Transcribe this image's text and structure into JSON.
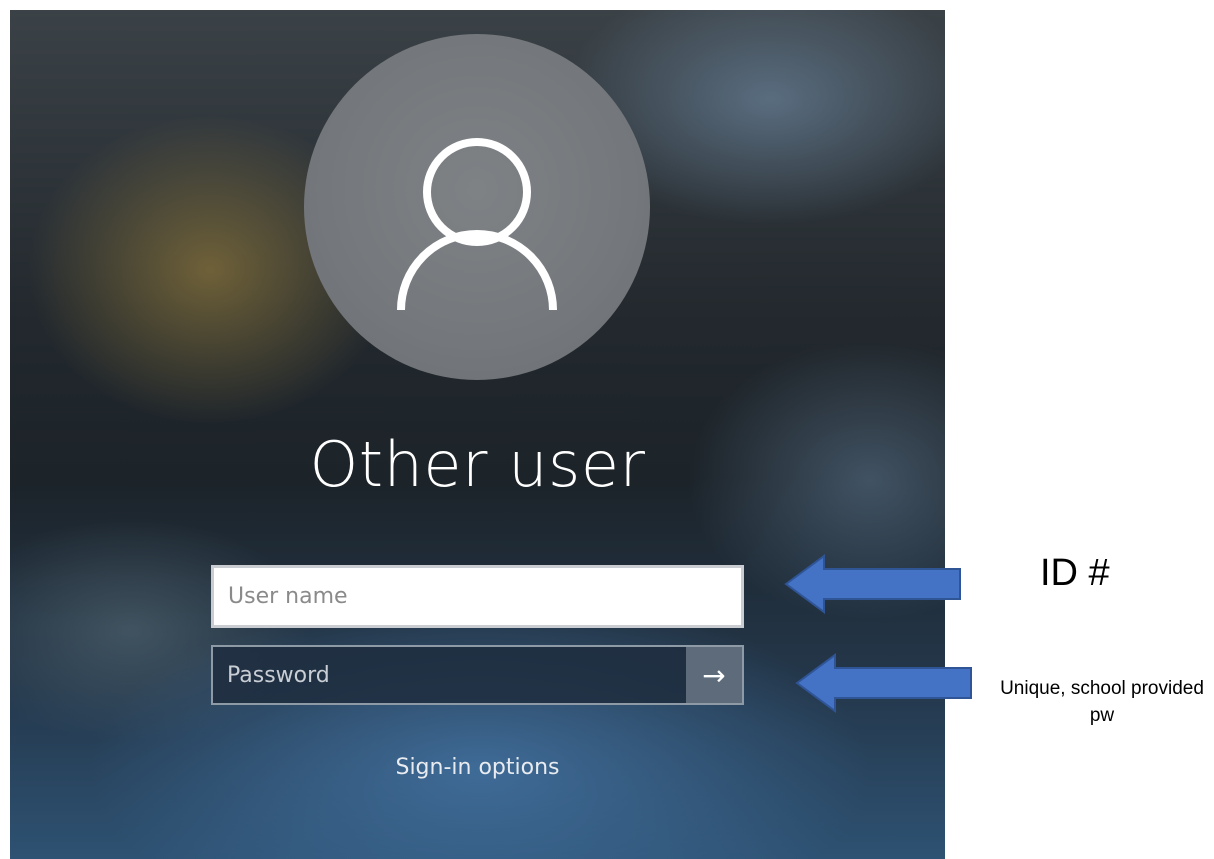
{
  "lock_screen": {
    "user_title": "Other user",
    "username": {
      "placeholder": "User name",
      "value": ""
    },
    "password": {
      "placeholder": "Password",
      "value": ""
    },
    "submit_glyph": "→",
    "signin_options_label": "Sign-in options"
  },
  "annotations": {
    "username_note": "ID #",
    "password_note": "Unique, school provided pw"
  },
  "icons": {
    "avatar": "user-silhouette-icon",
    "submit": "arrow-right-icon",
    "callout": "left-arrow-callout-icon"
  },
  "colors": {
    "callout_fill": "#4472C4",
    "callout_stroke": "#2F5597",
    "password_bg": "#1E2D3E",
    "submit_bg": "#5D6B7B"
  }
}
